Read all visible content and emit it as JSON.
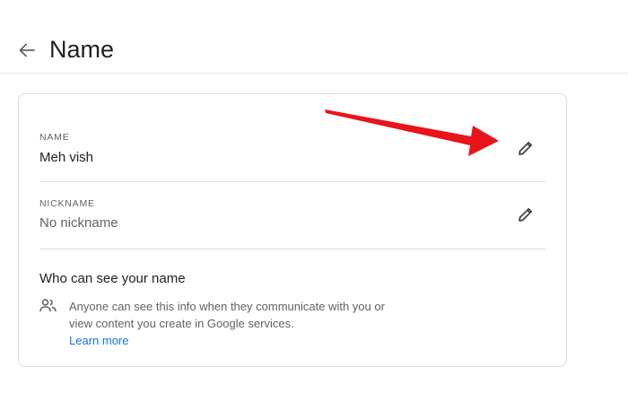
{
  "header": {
    "title": "Name",
    "back_icon": "arrow-back-icon"
  },
  "name_field": {
    "label": "NAME",
    "value": "Meh vish",
    "edit_icon": "pencil-icon"
  },
  "nickname_field": {
    "label": "NICKNAME",
    "value": "No nickname",
    "edit_icon": "pencil-icon"
  },
  "visibility": {
    "title": "Who can see your name",
    "icon": "people-icon",
    "description": "Anyone can see this info when they communicate with you or view content you create in Google services.",
    "link_label": "Learn more"
  },
  "annotation": {
    "type": "red-arrow",
    "color": "#e8141a",
    "points_to": "name edit button"
  },
  "colors": {
    "link": "#1a73e8",
    "divider": "#dadce0",
    "secondary_text": "#5f6368"
  }
}
